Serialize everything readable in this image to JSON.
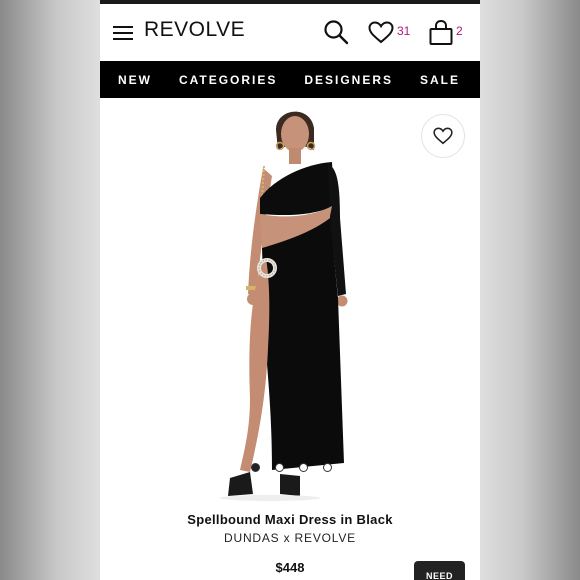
{
  "header": {
    "logo": "REVOLVE",
    "wishlist_count": "31",
    "bag_count": "2"
  },
  "nav": {
    "items": [
      "NEW",
      "CATEGORIES",
      "DESIGNERS",
      "SALE"
    ]
  },
  "product": {
    "title": "Spellbound Maxi Dress in Black",
    "brand": "DUNDAS x REVOLVE",
    "price": "$448",
    "image_count": 4,
    "active_image": 1
  },
  "chat": {
    "label": "NEED"
  },
  "colors": {
    "accent": "#b0177f",
    "nav_bg": "#000000"
  }
}
